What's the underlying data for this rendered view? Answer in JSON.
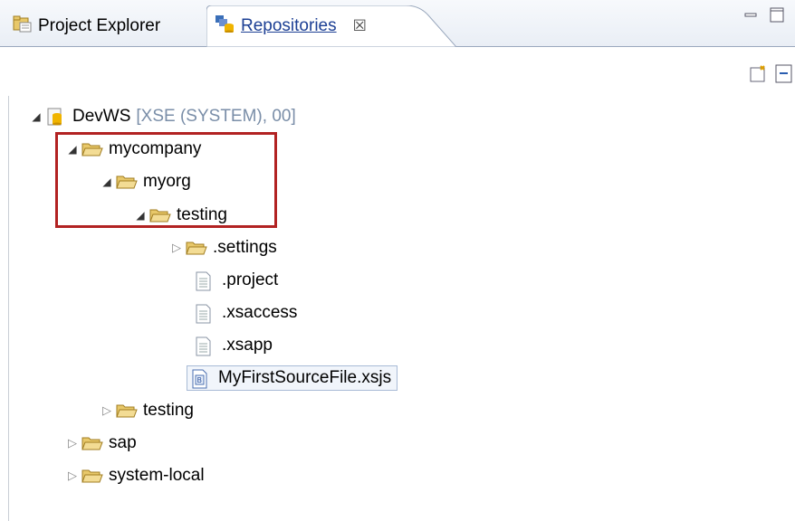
{
  "tabs": [
    {
      "label": "Project Explorer",
      "icon": "project-explorer-icon",
      "active": false
    },
    {
      "label": "Repositories",
      "icon": "repositories-icon",
      "active": true,
      "close": "☒"
    }
  ],
  "tree": {
    "root": {
      "label": "DevWS",
      "decoration": "[XSE (SYSTEM), 00]"
    },
    "items": [
      {
        "id": "mycompany",
        "label": "mycompany"
      },
      {
        "id": "myorg",
        "label": "myorg"
      },
      {
        "id": "testing-inner",
        "label": "testing"
      },
      {
        "id": "settings",
        "label": ".settings"
      },
      {
        "id": "project",
        "label": ".project"
      },
      {
        "id": "xsaccess",
        "label": ".xsaccess"
      },
      {
        "id": "xsapp",
        "label": ".xsapp"
      },
      {
        "id": "source",
        "label": "MyFirstSourceFile.xsjs"
      },
      {
        "id": "testing-outer",
        "label": "testing"
      },
      {
        "id": "sap",
        "label": "sap"
      },
      {
        "id": "system-local",
        "label": "system-local"
      }
    ]
  },
  "colors": {
    "highlight_box": "#b22222",
    "folder": "#e8c86a",
    "decoration": "#7a8ea8"
  }
}
